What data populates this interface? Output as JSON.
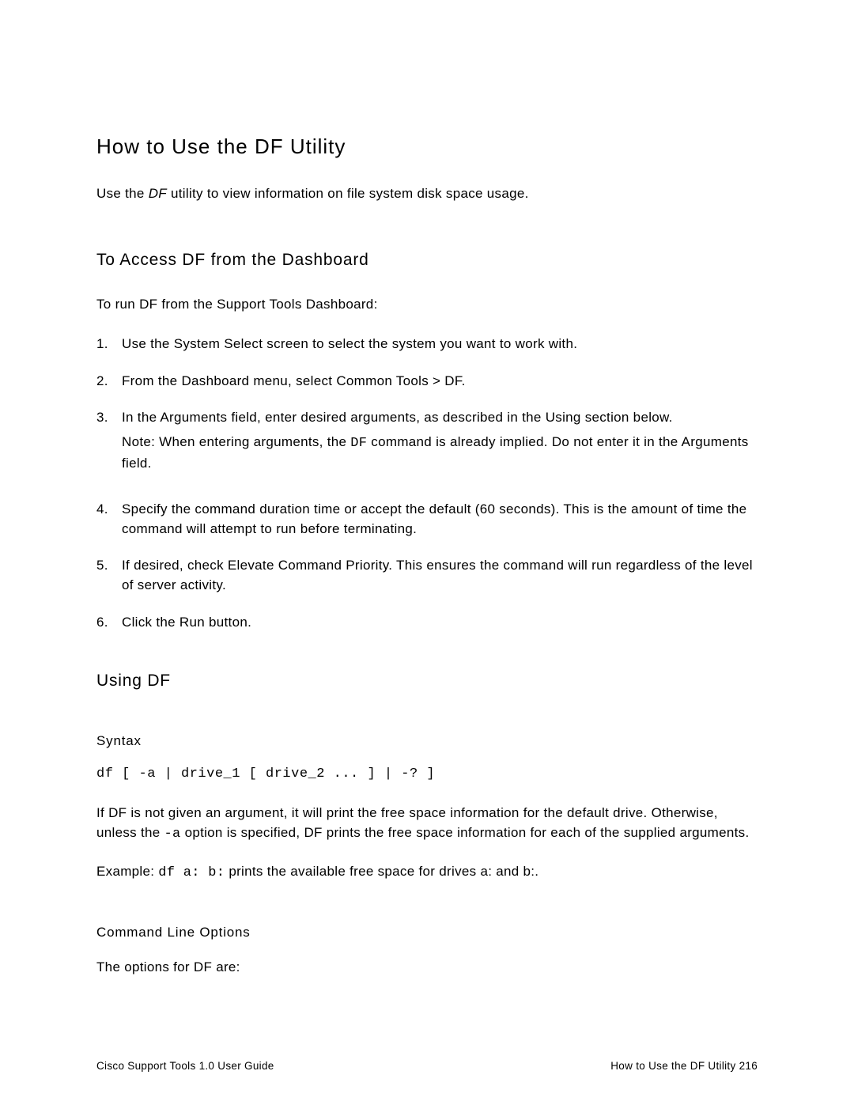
{
  "title": "How to Use the DF Utility",
  "intro_pre": "Use the ",
  "intro_em": "DF",
  "intro_post": " utility to view information on file system disk space usage.",
  "section1_heading": "To Access DF from the Dashboard",
  "section1_lead": "To run DF from the Support Tools Dashboard:",
  "steps": {
    "n1": "1.",
    "s1": "Use the System Select screen to select the system you want to work with.",
    "n2": "2.",
    "s2": "From the Dashboard menu, select Common Tools > DF.",
    "n3": "3.",
    "s3": "In the Arguments field, enter desired arguments, as described in the Using section below.",
    "s3_note_pre": "Note: When entering arguments, the ",
    "s3_note_code": "DF",
    "s3_note_post": " command is already implied. Do not enter it in the Arguments field.",
    "n4": "4.",
    "s4": "Specify the command duration time or accept the default (60 seconds). This is the amount of time the command will attempt to run before terminating.",
    "n5": "5.",
    "s5": "If desired, check Elevate Command Priority. This ensures the command will run regardless of the level of server activity.",
    "n6": "6.",
    "s6": "Click the Run button."
  },
  "using_heading": "Using DF",
  "syntax_heading": "Syntax",
  "syntax_line": "df [ -a | drive_1 [ drive_2 ... ] | -? ]",
  "body_pre": "If DF is not given an argument, it will print the free space information for the default drive. Otherwise, unless the ",
  "body_code": "-a",
  "body_post": " option is specified, DF prints the free space information for each of the supplied arguments.",
  "example_pre": "Example: ",
  "example_code": "df a: b:",
  "example_post": " prints the available free space for drives a: and b:.",
  "cmdline_heading": "Command Line Options",
  "cmdline_body": "The options for DF are:",
  "footer_left": "Cisco Support Tools 1.0 User Guide",
  "footer_right": "How to Use the DF Utility   216"
}
